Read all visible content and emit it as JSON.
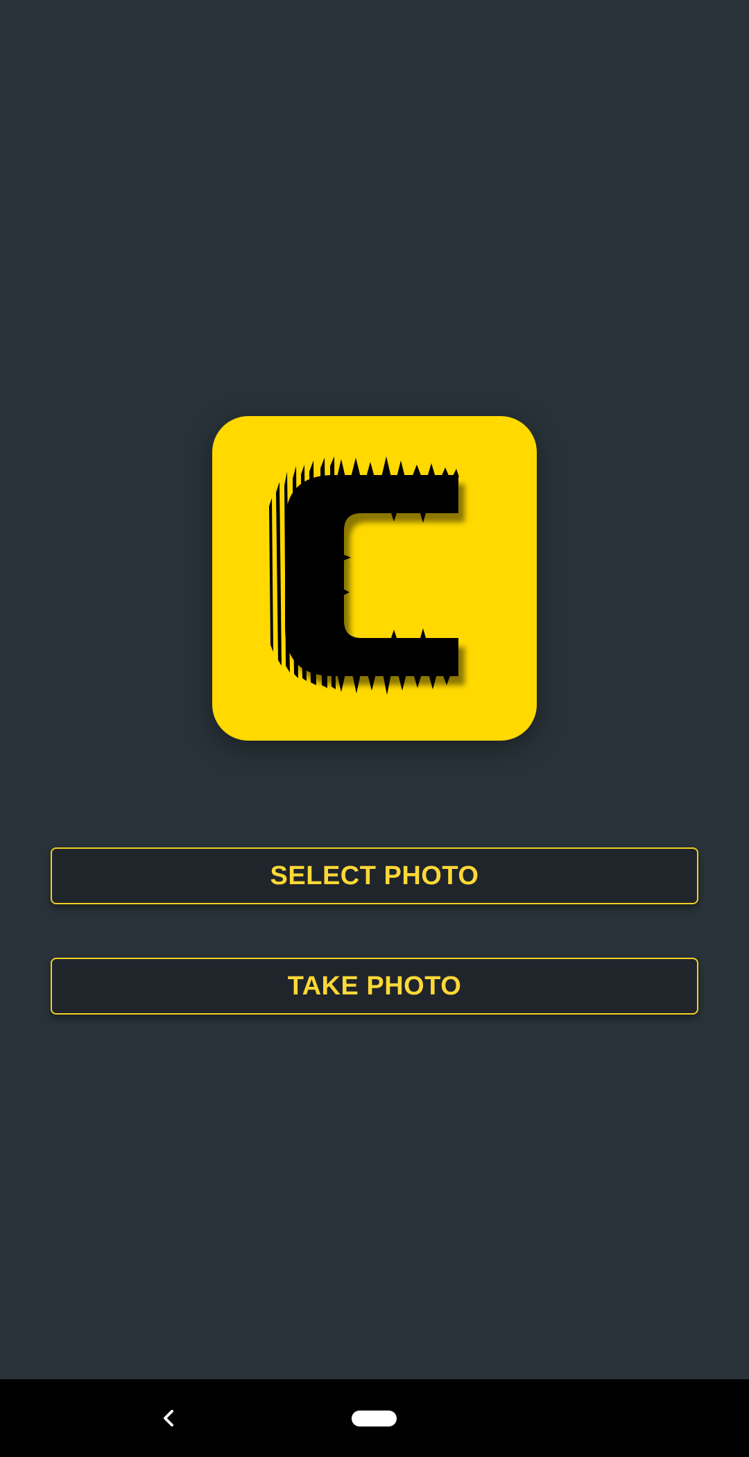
{
  "colors": {
    "background": "#283238",
    "accent": "#fdd836",
    "logo_background": "#ffd900",
    "button_background": "#20252b",
    "nav_bar": "#000000"
  },
  "logo": {
    "letter": "C",
    "icon": "glitch-letter-c-logo"
  },
  "buttons": {
    "select_photo": "SELECT PHOTO",
    "take_photo": "TAKE PHOTO"
  },
  "nav": {
    "back_icon": "chevron-left-icon",
    "home_icon": "home-pill-icon"
  }
}
